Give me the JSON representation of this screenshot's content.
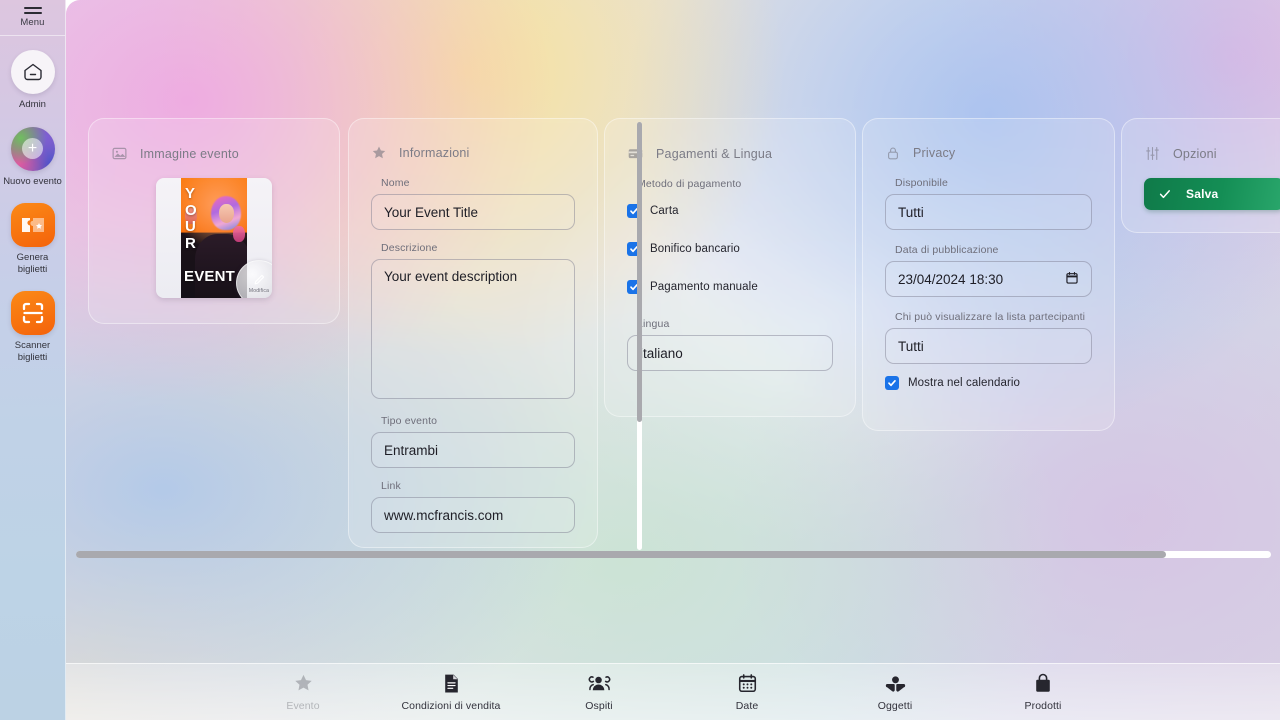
{
  "sidebar": {
    "menu_label": "Menu",
    "items": [
      {
        "label": "Admin",
        "icon": "home-icon"
      },
      {
        "label": "Nuovo evento",
        "icon": "plus-icon"
      },
      {
        "label": "Genera biglietti",
        "icon": "ticket-icon"
      },
      {
        "label": "Scanner biglietti",
        "icon": "qr-scanner-icon"
      }
    ]
  },
  "panels": {
    "image": {
      "title": "Immagine evento",
      "icon": "image-icon",
      "poster_letters": [
        "Y",
        "O",
        "U",
        "R"
      ],
      "poster_event_text": "EVENT",
      "edit_badge_label": "Modifica"
    },
    "info": {
      "title": "Informazioni",
      "icon": "star-icon",
      "fields": {
        "name_label": "Nome",
        "name_value": "Your Event Title",
        "description_label": "Descrizione",
        "description_value": "Your event description",
        "type_label": "Tipo evento",
        "type_value": "Entrambi",
        "link_label": "Link",
        "link_value": "www.mcfrancis.com"
      }
    },
    "payments": {
      "title": "Pagamenti & Lingua",
      "icon": "credit-card-icon",
      "method_label": "Metodo di pagamento",
      "methods": [
        {
          "label": "Carta",
          "checked": true
        },
        {
          "label": "Bonifico bancario",
          "checked": true
        },
        {
          "label": "Pagamento manuale",
          "checked": true
        }
      ],
      "language_label": "Lingua",
      "language_value": "italiano"
    },
    "privacy": {
      "title": "Privacy",
      "icon": "lock-icon",
      "available_label": "Disponibile",
      "available_value": "Tutti",
      "publish_date_label": "Data di pubblicazione",
      "publish_date_value": "23/04/2024  18:30",
      "viewer_label": "Chi può visualizzare la lista partecipanti",
      "viewer_value": "Tutti",
      "calendar_checkbox_label": "Mostra nel calendario",
      "calendar_checkbox_checked": true
    },
    "options": {
      "title": "Opzioni",
      "icon": "sliders-icon",
      "save_label": "Salva"
    }
  },
  "bottom_nav": {
    "items": [
      {
        "label": "Evento",
        "icon": "star-icon",
        "active": false,
        "dim": true
      },
      {
        "label": "Condizioni di vendita",
        "icon": "document-icon",
        "dim": false
      },
      {
        "label": "Ospiti",
        "icon": "users-icon",
        "dim": false
      },
      {
        "label": "Date",
        "icon": "calendar-icon",
        "dim": false
      },
      {
        "label": "Oggetti",
        "icon": "objects-icon",
        "dim": false
      },
      {
        "label": "Prodotti",
        "icon": "bag-icon",
        "dim": false
      }
    ]
  },
  "colors": {
    "checkbox_blue": "#1a73e8",
    "save_green": "#12884f",
    "accent_orange": "#f4710c",
    "scrollbar_thumb": "#a9a9ae"
  }
}
